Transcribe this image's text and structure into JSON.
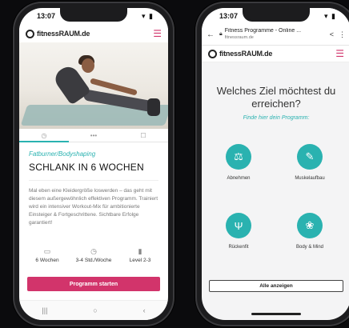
{
  "left_phone": {
    "status": {
      "time": "13:07",
      "icons": "▾ ▮"
    },
    "logo_text": "fitnessRAUM.de",
    "tabs": [
      "◷",
      "•••",
      "☐"
    ],
    "category": "Fatburner/Bodyshaping",
    "title": "SCHLANK IN 6 WOCHEN",
    "description": "Mal eben eine Kleidergröße loswerden – das geht mit diesem außergewöhnlich effektiven Programm. Trainiert wird ein intensiver Workout-Mix für ambitionierte Einsteiger & Fortgeschrittene. Sichtbare Erfolge garantiert!",
    "stats": [
      {
        "icon": "▭",
        "label": "6 Wochen"
      },
      {
        "icon": "◷",
        "label": "3-4 Std./Woche"
      },
      {
        "icon": "▮",
        "label": "Level 2-3"
      }
    ],
    "cta_label": "Programm starten",
    "nav": [
      "|||",
      "○",
      "‹"
    ]
  },
  "right_phone": {
    "status": {
      "time": "13:07",
      "icons": "▾ ▮"
    },
    "browser": {
      "page_title": "Fitness Programme - Online ...",
      "url": "fitnessraum.de"
    },
    "logo_text": "fitnessRAUM.de",
    "heading": "Welches Ziel möchtest du erreichen?",
    "subheading": "Finde hier dein Programm:",
    "goals": [
      {
        "label": "Abnehmen",
        "icon": "scale-icon"
      },
      {
        "label": "Muskelaufbau",
        "icon": "dumbbell-icon"
      },
      {
        "label": "Rückenfit",
        "icon": "back-icon"
      },
      {
        "label": "Body & Mind",
        "icon": "lotus-icon"
      }
    ],
    "show_all_label": "Alle anzeigen"
  },
  "colors": {
    "accent": "#d2346b",
    "teal": "#2ab2b0"
  }
}
